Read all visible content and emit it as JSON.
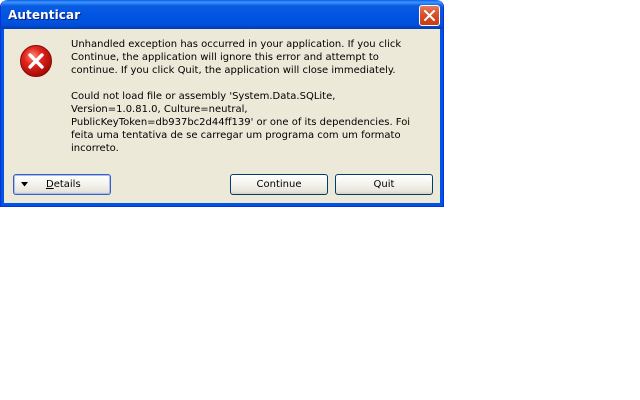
{
  "window": {
    "title": "Autenticar"
  },
  "message": {
    "paragraph1": "Unhandled exception has occurred in your application. If you click Continue, the application will ignore this error and attempt to continue. If you click Quit, the application will close immediately.",
    "paragraph2": "Could not load file or assembly 'System.Data.SQLite, Version=1.0.81.0, Culture=neutral, PublicKeyToken=db937bc2d44ff139' or one of its dependencies. Foi feita uma tentativa de se carregar um programa com um formato incorreto."
  },
  "buttons": {
    "details": "Details",
    "continue": "Continue",
    "quit": "Quit"
  },
  "icons": {
    "error": "error-icon",
    "close": "close-icon",
    "details_arrow": "triangle-down-icon"
  },
  "colors": {
    "titlebar": "#0054e3",
    "close_button": "#d8502b",
    "dialog_background": "#ece9d8",
    "error_icon": "#e0241c"
  }
}
